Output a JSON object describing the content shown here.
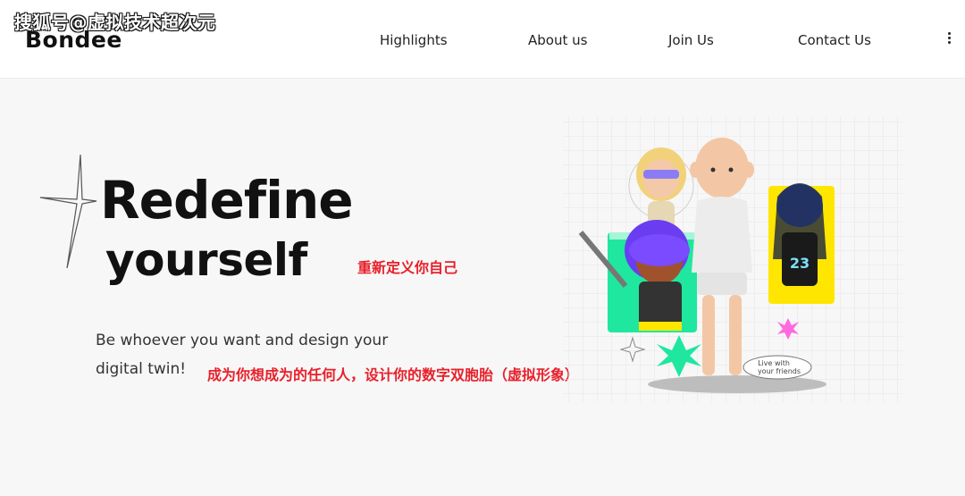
{
  "watermark": "搜狐号@虚拟技术超次元",
  "header": {
    "logo": "Bondee",
    "nav": [
      "Highlights",
      "About us",
      "Join Us",
      "Contact Us"
    ]
  },
  "hero": {
    "title_line1": "Redefine",
    "title_line2": "yourself",
    "title_cn": "重新定义你自己",
    "subtitle_line1": "Be whoever you want and design your",
    "subtitle_line2": "digital twin!",
    "subtitle_cn": "成为你想成为的任何人，设计你的数字双胞胎（虚拟形象）",
    "bubble_line1": "Live with",
    "bubble_line2": "your friends",
    "jersey_number": "23"
  },
  "colors": {
    "accent_green": "#1fe7a0",
    "accent_yellow": "#ffe600",
    "cn_red": "#e8202a",
    "avatar_purple": "#6a3df0",
    "avatar_blue": "#3d6df0"
  }
}
